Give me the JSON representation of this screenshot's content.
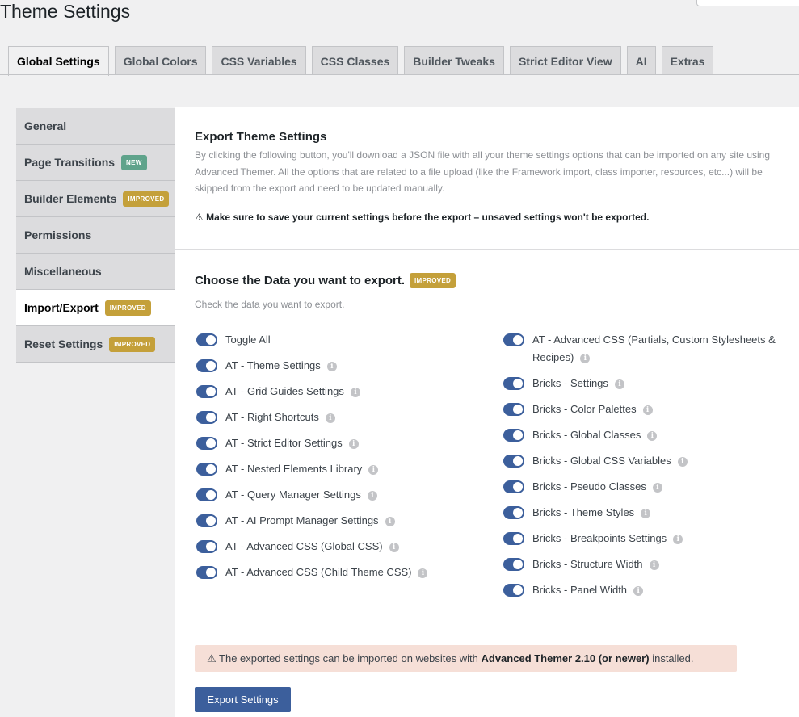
{
  "page_title": "Theme Settings",
  "tabs": [
    {
      "label": "Global Settings",
      "active": true
    },
    {
      "label": "Global Colors"
    },
    {
      "label": "CSS Variables"
    },
    {
      "label": "CSS Classes"
    },
    {
      "label": "Builder Tweaks"
    },
    {
      "label": "Strict Editor View"
    },
    {
      "label": "AI"
    },
    {
      "label": "Extras"
    }
  ],
  "sidebar": {
    "items": [
      {
        "label": "General"
      },
      {
        "label": "Page Transitions",
        "badge": "NEW"
      },
      {
        "label": "Builder Elements",
        "badge": "IMPROVED"
      },
      {
        "label": "Permissions"
      },
      {
        "label": "Miscellaneous"
      },
      {
        "label": "Import/Export",
        "badge": "IMPROVED",
        "active": true
      },
      {
        "label": "Reset Settings",
        "badge": "IMPROVED"
      }
    ]
  },
  "export_section": {
    "title": "Export Theme Settings",
    "description": "By clicking the following button, you'll download a JSON file with all your theme settings options that can be imported on any site using Advanced Themer. All the options that are related to a file upload (like the Framework import, class importer, resources, etc...) will be skipped from the export and need to be updated manually.",
    "warning": "⚠ Make sure to save your current settings before the export – unsaved settings won't be exported."
  },
  "choose_section": {
    "title": "Choose the Data you want to export.",
    "badge": "IMPROVED",
    "subtitle": "Check the data you want to export."
  },
  "toggles_left": [
    {
      "label": "Toggle All",
      "info": false
    },
    {
      "label": "AT - Theme Settings",
      "info": true
    },
    {
      "label": "AT - Grid Guides Settings",
      "info": true
    },
    {
      "label": "AT - Right Shortcuts",
      "info": true
    },
    {
      "label": "AT - Strict Editor Settings",
      "info": true
    },
    {
      "label": "AT - Nested Elements Library",
      "info": true
    },
    {
      "label": "AT - Query Manager Settings",
      "info": true
    },
    {
      "label": "AT - AI Prompt Manager Settings",
      "info": true
    },
    {
      "label": "AT - Advanced CSS (Global CSS)",
      "info": true
    },
    {
      "label": "AT - Advanced CSS (Child Theme CSS)",
      "info": true
    }
  ],
  "toggles_right": [
    {
      "label": "AT - Advanced CSS (Partials, Custom Stylesheets & Recipes)",
      "info": true
    },
    {
      "label": "Bricks - Settings",
      "info": true
    },
    {
      "label": "Bricks - Color Palettes",
      "info": true
    },
    {
      "label": "Bricks - Global Classes",
      "info": true
    },
    {
      "label": "Bricks - Global CSS Variables",
      "info": true
    },
    {
      "label": "Bricks - Pseudo Classes",
      "info": true
    },
    {
      "label": "Bricks - Theme Styles",
      "info": true
    },
    {
      "label": "Bricks - Breakpoints Settings",
      "info": true
    },
    {
      "label": "Bricks - Structure Width",
      "info": true
    },
    {
      "label": "Bricks - Panel Width",
      "info": true
    }
  ],
  "notice": {
    "prefix": "⚠ The exported settings can be imported on websites with ",
    "bold": "Advanced Themer 2.10 (or newer)",
    "suffix": " installed."
  },
  "export_button": "Export Settings",
  "info_glyph": "i",
  "colors": {
    "toggle_on": "#3c5f9c",
    "badge_new": "#5fa38b",
    "badge_improved": "#c4a03a",
    "notice_bg": "#f6dfd7"
  }
}
